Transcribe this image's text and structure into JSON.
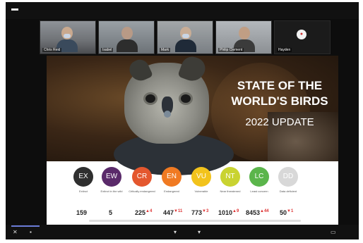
{
  "meeting": {
    "participants": [
      {
        "name": "Chris Reid"
      },
      {
        "name": "Isabel"
      },
      {
        "name": "Mark"
      },
      {
        "name": "Philip Clement"
      },
      {
        "name": "Hayden"
      }
    ]
  },
  "slide": {
    "title_line1": "STATE OF THE",
    "title_line2": "WORLD'S BIRDS",
    "title_line3": "2022 UPDATE",
    "categories": [
      {
        "code": "EX",
        "label": "Extinct",
        "color": "#2f2f2f",
        "count": "159",
        "change": ""
      },
      {
        "code": "EW",
        "label": "Extinct in the wild",
        "color": "#5a2a6a",
        "count": "5",
        "change": ""
      },
      {
        "code": "CR",
        "label": "Critically endangered",
        "color": "#e4572e",
        "count": "225",
        "change": "▲4"
      },
      {
        "code": "EN",
        "label": "Endangered",
        "color": "#f07a22",
        "count": "447",
        "change": "▼11"
      },
      {
        "code": "VU",
        "label": "Vulnerable",
        "color": "#f2c31c",
        "count": "773",
        "change": "▼3"
      },
      {
        "code": "NT",
        "label": "Near threatened",
        "color": "#c9d331",
        "count": "1010",
        "change": "▲9"
      },
      {
        "code": "LC",
        "label": "Least concern",
        "color": "#5bb54b",
        "count": "8453",
        "change": "▲44"
      },
      {
        "code": "DD",
        "label": "Data deficient",
        "color": "#d8d8d8",
        "count": "50",
        "change": "▼1"
      }
    ]
  },
  "icons": {
    "topbar": "minimize-icon",
    "bottom": [
      "mic-icon",
      "camera-icon",
      "chat-icon",
      "share-icon",
      "fullscreen-icon"
    ]
  }
}
